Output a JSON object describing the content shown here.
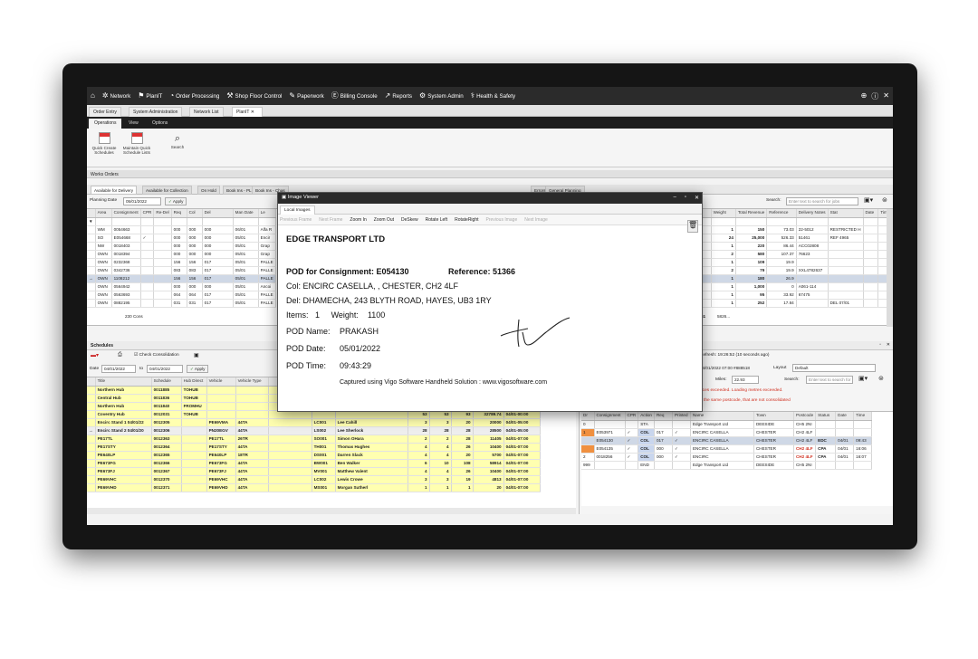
{
  "nav": {
    "items": [
      "Network",
      "PlanIT",
      "Order Processing",
      "Shop Floor Control",
      "Paperwork",
      "Billing Console",
      "Reports",
      "System Admin",
      "Health & Safety"
    ]
  },
  "doc_tabs": [
    "Order Entry",
    "System Administration",
    "Network List",
    "PlanIT"
  ],
  "ribbon_tabs": [
    "Operations",
    "View",
    "Options"
  ],
  "ribbon": {
    "b1": "Quick Create Schedules",
    "b2": "Maintain Quick Schedule Lists",
    "b3": "Search"
  },
  "works_orders": "Works Orders",
  "filter_tabs": [
    "Available for Delivery",
    "Available for Collection",
    "On Hold",
    "Book Ins - PLN",
    "Book Ins - Chas",
    "Load and Go",
    "All Works Orders",
    "Deliveries for Planned",
    "Errors",
    "General Planning"
  ],
  "filter": {
    "label": "Planning Date",
    "date": "05/01/2022",
    "apply": "Apply",
    "search_label": "Search:",
    "search_placeholder": "Enter text to search for jobs"
  },
  "upper_cols": [
    "Area",
    "Consignment",
    "CPR",
    "Re-Del",
    "Req",
    "Col",
    "Del",
    "Man Date",
    "Le"
  ],
  "upper_rows": [
    [
      "WM",
      "0054663",
      "",
      "",
      "000",
      "000",
      "000",
      "06/01",
      "Alfa R"
    ],
    [
      "SO",
      "E054668",
      "✓",
      "",
      "000",
      "000",
      "000",
      "05/01",
      "Encir"
    ],
    [
      "NW",
      "0018403",
      "",
      "",
      "000",
      "000",
      "000",
      "05/01",
      "Grap"
    ],
    [
      "OWN",
      "0018394",
      "",
      "",
      "000",
      "000",
      "000",
      "05/01",
      "Grap"
    ],
    [
      "OWN",
      "0232368",
      "",
      "",
      "156",
      "156",
      "017",
      "05/01",
      "PALLE"
    ],
    [
      "OWN",
      "0342736",
      "",
      "",
      "083",
      "083",
      "017",
      "05/01",
      "PALLE"
    ],
    [
      "OWN",
      "1108212",
      "",
      "",
      "156",
      "156",
      "017",
      "05/01",
      "PALLE"
    ],
    [
      "OWN",
      "0564942",
      "",
      "",
      "000",
      "000",
      "000",
      "05/01",
      "Ancoi"
    ],
    [
      "OWN",
      "0563693",
      "",
      "",
      "064",
      "064",
      "017",
      "05/01",
      "PALLE"
    ],
    [
      "OWN",
      "0882195",
      "",
      "",
      "031",
      "031",
      "017",
      "05/01",
      "PALLE"
    ]
  ],
  "upper_count": "230 Cons",
  "right_cols": [
    "Weight",
    "Total Revenue",
    "Reference",
    "Delivery Notes",
    "Stat",
    "Date",
    "Time"
  ],
  "right_rows": [
    [
      "1",
      "150",
      "73.03",
      "22-5012",
      "RESTRICTED H"
    ],
    [
      "24",
      "25,000",
      "526.33",
      "51461",
      "REF 4965"
    ],
    [
      "1",
      "220",
      "86.44",
      "ACC02808",
      ""
    ],
    [
      "2",
      "580",
      "107.37",
      "76623",
      ""
    ],
    [
      "1",
      "109",
      "19.9",
      "",
      ""
    ],
    [
      "2",
      "79",
      "19.9",
      "XXL4782637",
      ""
    ],
    [
      "1",
      "180",
      "26.9",
      "",
      ""
    ],
    [
      "1",
      "1,000",
      "0",
      "A061-114",
      ""
    ],
    [
      "1",
      "95",
      "33.92",
      "67475",
      ""
    ],
    [
      "1",
      "252",
      "17.84",
      "",
      "DEL 07/01"
    ]
  ],
  "right_totals": [
    "51",
    "5826..."
  ],
  "modal": {
    "title": "Image Viewer",
    "tab": "Local Images",
    "tools": [
      "Previous Frame",
      "Next Frame",
      "Zoom In",
      "Zoom Out",
      "DeSkew",
      "Rotate Left",
      "RotateRight",
      "Previous Image",
      "Next Image"
    ],
    "company": "EDGE TRANSPORT LTD",
    "pod_for": "POD for Consignment: E054130",
    "reference": "Reference: 51366",
    "col": "Col: ENCIRC CASELLA, , CHESTER, CH2 4LF",
    "del": "Del: DHAMECHA, 243 BLYTH ROAD, HAYES, UB3 1RY",
    "items_label": "Items:",
    "items": "1",
    "weight_label": "Weight:",
    "weight": "1100",
    "pod_name_label": "POD Name:",
    "pod_name": "PRAKASH",
    "pod_date_label": "POD Date:",
    "pod_date": "05/01/2022",
    "pod_time_label": "POD Time:",
    "pod_time": "09:43:29",
    "captured": "Captured using Vigo Software Handheld Solution : www.vigosoftware.com"
  },
  "schedules": {
    "title": "Schedules",
    "check": "Check Consolidation",
    "date_label": "Date",
    "from": "04/01/2022",
    "to_label": "to",
    "to": "04/01/2022",
    "apply": "Apply"
  },
  "sched_cols": [
    "Title",
    "Schedule",
    "Hub Direct",
    "Vehicle",
    "Vehicle Type",
    "",
    "Lead",
    "Driver",
    "",
    "",
    "",
    "",
    "Date"
  ],
  "sched_rows": [
    [
      "Northern Hub",
      "0011885",
      "TOHUB",
      "",
      "",
      "",
      "",
      "",
      "",
      "",
      "",
      "",
      ""
    ],
    [
      "Central Hub",
      "0011836",
      "TOHUB",
      "",
      "",
      "",
      "",
      "",
      "",
      "",
      "",
      "",
      ""
    ],
    [
      "Northern Hub",
      "0011840",
      "FROMHU",
      "",
      "",
      "",
      "",
      "",
      "",
      "",
      "",
      "",
      ""
    ],
    [
      "Coventry Hub",
      "0012031",
      "TOHUB",
      "",
      "",
      "",
      "",
      "",
      "53",
      "53",
      "93",
      "32789.74",
      "04/01-00:00"
    ],
    [
      "Encirc Stand 1 04/01/22",
      "0012305",
      "",
      "PE69VMA",
      "44TA",
      "",
      "LC001",
      "Lee Cahill",
      "3",
      "3",
      "20",
      "20000",
      "04/01-05:00"
    ],
    [
      "Encirc Stand 2 04/01/20",
      "0012306",
      "",
      "PN20EGV",
      "44TA",
      "",
      "LS002",
      "Lee Sherlock",
      "28",
      "28",
      "28",
      "28500",
      "04/01-05:00"
    ],
    [
      "PE17TL",
      "0012363",
      "",
      "PE17TL",
      "26TR",
      "",
      "SO001",
      "Simon OHara",
      "2",
      "2",
      "28",
      "11405",
      "04/01-07:00"
    ],
    [
      "PE17STY",
      "0012364",
      "",
      "PE17STY",
      "44TA",
      "",
      "TH001",
      "Thomas Hughes",
      "4",
      "4",
      "26",
      "10400",
      "04/01-07:00"
    ],
    [
      "PE640LP",
      "0012365",
      "",
      "PE640LP",
      "18TR",
      "",
      "DS001",
      "Darren Slack",
      "4",
      "4",
      "20",
      "5700",
      "04/01-07:00"
    ],
    [
      "PE673FG",
      "0012366",
      "",
      "PE673FG",
      "44TA",
      "",
      "BW001",
      "Ben Walker",
      "6",
      "10",
      "108",
      "58914",
      "04/01-07:00"
    ],
    [
      "PE673FJ",
      "0012367",
      "",
      "PE673FJ",
      "44TA",
      "",
      "MV001",
      "Matthew Valent",
      "4",
      "4",
      "26",
      "10400",
      "04/01-07:00"
    ],
    [
      "PE69VHC",
      "0012370",
      "",
      "PE69VHC",
      "44TA",
      "",
      "LC002",
      "Lewis Crowe",
      "3",
      "3",
      "19",
      "4813",
      "04/01-07:00"
    ],
    [
      "PE69VHD",
      "0012371",
      "",
      "PE69VHD",
      "44TA",
      "",
      "MS001",
      "Morgan Sutherl",
      "1",
      "1",
      "1",
      "20",
      "04/01-07:00"
    ]
  ],
  "right_panel": {
    "refresh": "Refresh: 19:26:52 (10 seconds ago)",
    "date": "04/01/2022 07:00",
    "code": "#888518",
    "layout_label": "Layout",
    "layout": "Default",
    "miles_label": "Miles:",
    "miles": "22.93",
    "search_label": "Search:",
    "search_placeholder": "Enter text to search for",
    "warn1": "aces exceeded. Loading metres exceeded.",
    "warn2": "h the same postcode, that are not consolidated"
  },
  "stop_cols": [
    "Dr",
    "Consignment",
    "CPR",
    "Action",
    "Req",
    "Printed",
    "Name",
    "Town",
    "Postcode",
    "Status",
    "Date",
    "Time"
  ],
  "stop_rows": [
    [
      "0",
      "",
      "",
      "STA",
      "",
      "",
      "Edge Transport Ltd",
      "DEESIDE",
      "CH5 2NI",
      "",
      "",
      ""
    ],
    [
      "1",
      "E053971",
      "✓",
      "COL",
      "017",
      "✓",
      "ENCIRC CASELLA",
      "CHESTER",
      "CH2 4LF",
      "",
      "",
      ""
    ],
    [
      "",
      "E054130",
      "✓",
      "COL",
      "017",
      "✓",
      "ENCIRC CASELLA",
      "CHESTER",
      "CH2 4LF",
      "EDC",
      "04/01",
      "09:43"
    ],
    [
      "",
      "E054135",
      "✓",
      "COL",
      "000",
      "✓",
      "ENCIRC CASELLA",
      "CHESTER",
      "CH2 4LF",
      "CPA",
      "04/01",
      "16:06"
    ],
    [
      "2",
      "0018256",
      "✓",
      "COL",
      "000",
      "✓",
      "ENCIRC",
      "CHESTER",
      "CH2 4LF",
      "CPA",
      "04/01",
      "16:07"
    ],
    [
      "999",
      "",
      "",
      "END",
      "",
      "",
      "Edge Transport Ltd",
      "DEESIDE",
      "CH5 2NI",
      "",
      "",
      ""
    ]
  ],
  "colors": {
    "nav": "#2b2b2b",
    "yellow": "#ffffb0",
    "accent": "#1a3a8a",
    "warn": "#d03020"
  }
}
